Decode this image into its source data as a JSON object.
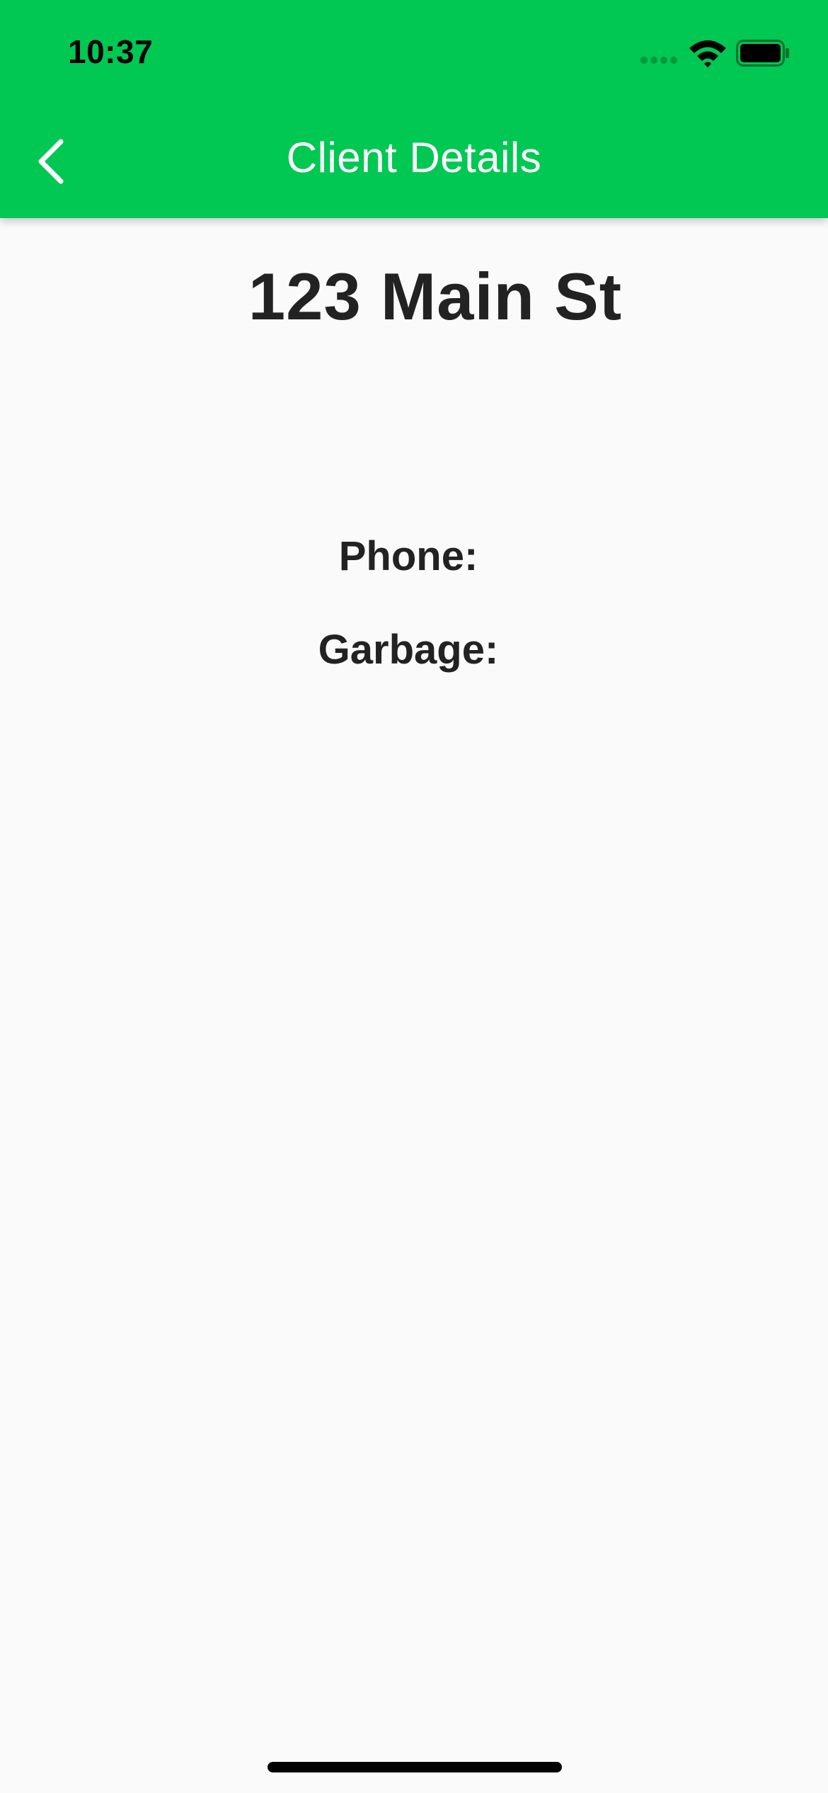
{
  "status_bar": {
    "time": "10:37"
  },
  "header": {
    "title": "Client Details",
    "back_icon": "chevron-left-icon",
    "background_color": "#00c853",
    "title_color": "#ffffff"
  },
  "client": {
    "address": "123 Main St",
    "phone_label": "Phone:",
    "garbage_label": "Garbage:"
  },
  "colors": {
    "page_background": "#fafafa",
    "text": "#222222"
  }
}
